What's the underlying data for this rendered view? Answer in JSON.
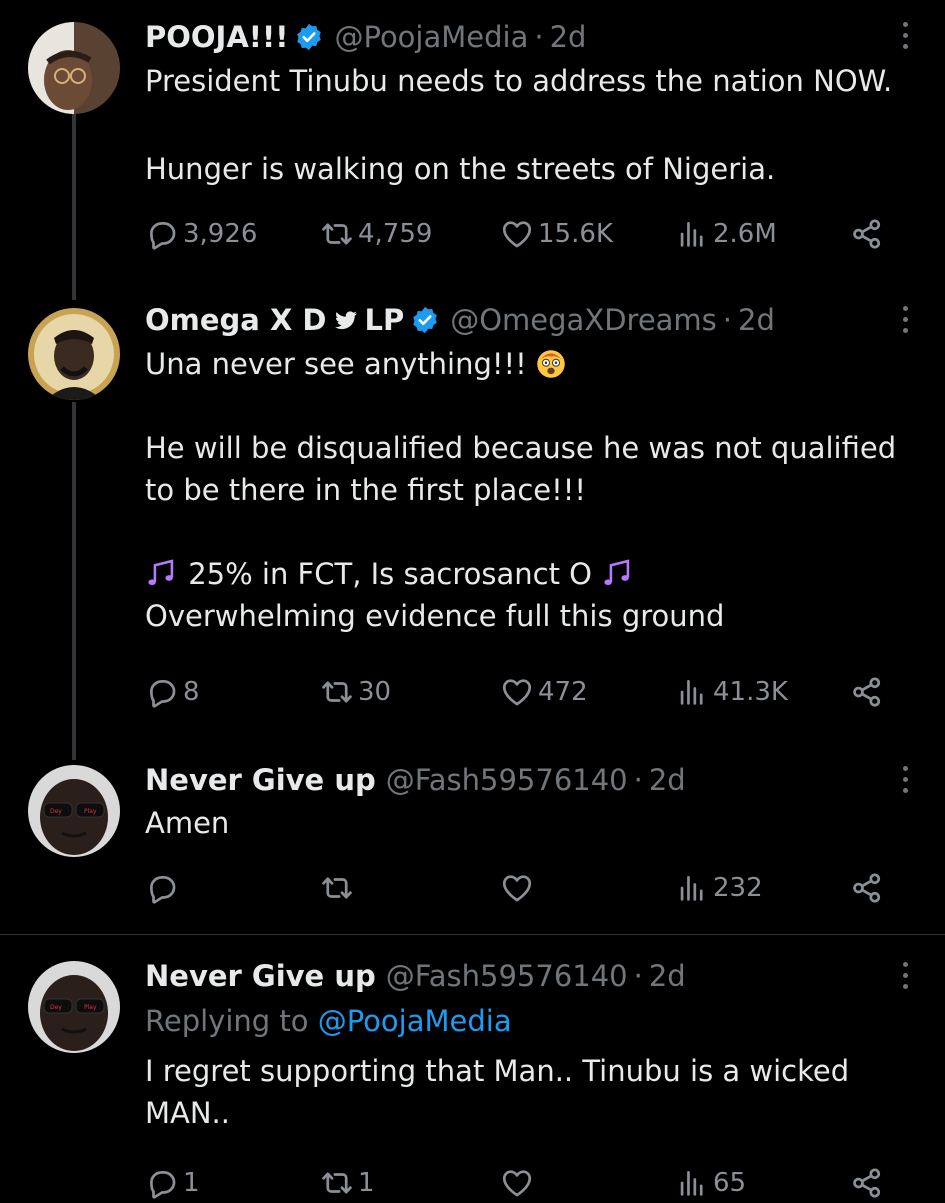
{
  "tweets": [
    {
      "name": "POOJA!!!",
      "verified": true,
      "handle": "@PoojaMedia",
      "dot": "·",
      "time": "2d",
      "text": [
        "President Tinubu needs to address the nation NOW.",
        "",
        "Hunger is walking on the streets of Nigeria."
      ],
      "replies": "3,926",
      "retweets": "4,759",
      "likes": "15.6K",
      "views": "2.6M"
    },
    {
      "name": "Omega X D",
      "name_suffix": "LP",
      "verified": true,
      "handle": "@OmegaXDreams",
      "dot": "·",
      "time": "2d",
      "line1": "Una never see anything!!!",
      "line2": "He will be disqualified because he was not qualified",
      "line3": "to be there in the first place!!!",
      "line4": "25% in FCT, Is sacrosanct  O",
      "line5": "Overwhelming evidence full this ground",
      "replies": "8",
      "retweets": "30",
      "likes": "472",
      "views": "41.3K"
    },
    {
      "name": "Never Give up",
      "handle": "@Fash59576140",
      "dot": "·",
      "time": "2d",
      "text": "Amen",
      "replies": "",
      "retweets": "",
      "likes": "",
      "views": "232"
    },
    {
      "name": "Never Give up",
      "handle": "@Fash59576140",
      "dot": "·",
      "time": "2d",
      "replying_label": "Replying to",
      "replying_to": "@PoojaMedia",
      "line1": "I regret supporting that Man.. Tinubu is a wicked",
      "line2": "MAN..",
      "replies": "1",
      "retweets": "1",
      "likes": "",
      "views": "65"
    }
  ],
  "colors": {
    "background": "#000000",
    "text": "#e7e9ea",
    "muted": "#71767b",
    "link": "#1d9bf0",
    "verified": "#1d9bf0"
  },
  "icons": [
    "reply-icon",
    "retweet-icon",
    "like-icon",
    "views-icon",
    "share-icon",
    "more-icon",
    "verified-badge-icon",
    "bird-icon",
    "astonished-face-emoji",
    "musical-notes-emoji"
  ]
}
